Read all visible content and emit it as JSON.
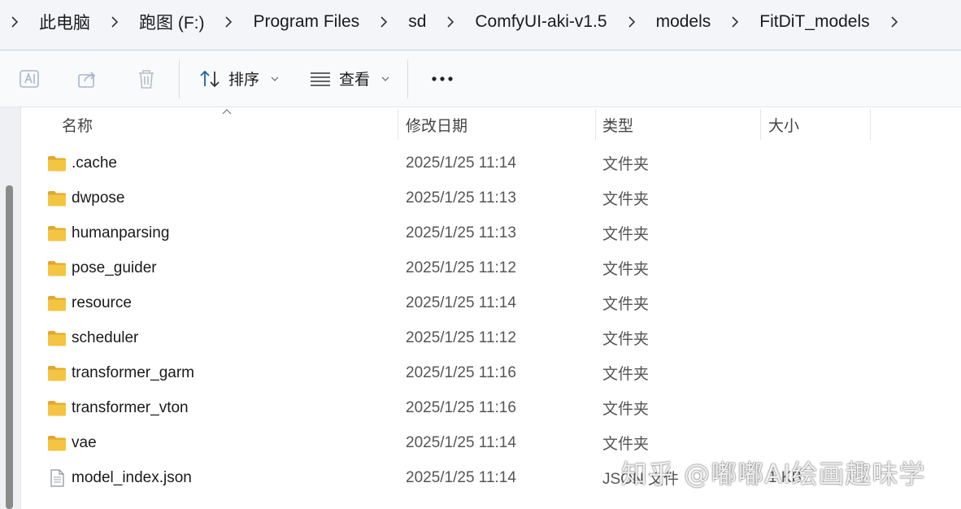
{
  "breadcrumb": [
    "此电脑",
    "跑图 (F:)",
    "Program Files",
    "sd",
    "ComfyUI-aki-v1.5",
    "models",
    "FitDiT_models"
  ],
  "toolbar": {
    "icons": [
      "rename-icon",
      "share-icon",
      "delete-icon"
    ],
    "sort_label": "排序",
    "view_label": "查看",
    "more_icon": "more-icon"
  },
  "columns": {
    "name": "名称",
    "date": "修改日期",
    "type": "类型",
    "size": "大小"
  },
  "files": [
    {
      "name": ".cache",
      "date": "2025/1/25 11:14",
      "type": "文件夹",
      "size": "",
      "icon": "folder-icon"
    },
    {
      "name": "dwpose",
      "date": "2025/1/25 11:13",
      "type": "文件夹",
      "size": "",
      "icon": "folder-icon"
    },
    {
      "name": "humanparsing",
      "date": "2025/1/25 11:13",
      "type": "文件夹",
      "size": "",
      "icon": "folder-icon"
    },
    {
      "name": "pose_guider",
      "date": "2025/1/25 11:12",
      "type": "文件夹",
      "size": "",
      "icon": "folder-icon"
    },
    {
      "name": "resource",
      "date": "2025/1/25 11:14",
      "type": "文件夹",
      "size": "",
      "icon": "folder-icon"
    },
    {
      "name": "scheduler",
      "date": "2025/1/25 11:12",
      "type": "文件夹",
      "size": "",
      "icon": "folder-icon"
    },
    {
      "name": "transformer_garm",
      "date": "2025/1/25 11:16",
      "type": "文件夹",
      "size": "",
      "icon": "folder-icon"
    },
    {
      "name": "transformer_vton",
      "date": "2025/1/25 11:16",
      "type": "文件夹",
      "size": "",
      "icon": "folder-icon"
    },
    {
      "name": "vae",
      "date": "2025/1/25 11:14",
      "type": "文件夹",
      "size": "",
      "icon": "folder-icon"
    },
    {
      "name": "model_index.json",
      "date": "2025/1/25 11:14",
      "type": "JSON 文件",
      "size": "1 KB",
      "icon": "json-file-icon"
    }
  ],
  "watermark": "知乎 @嘟嘟AI绘画趣味学",
  "colors": {
    "address_bg": "#f3f5f9",
    "toolbar_bg": "#f9fafc",
    "folder_yellow": "#f4c542",
    "folder_dark": "#e0a82e"
  }
}
